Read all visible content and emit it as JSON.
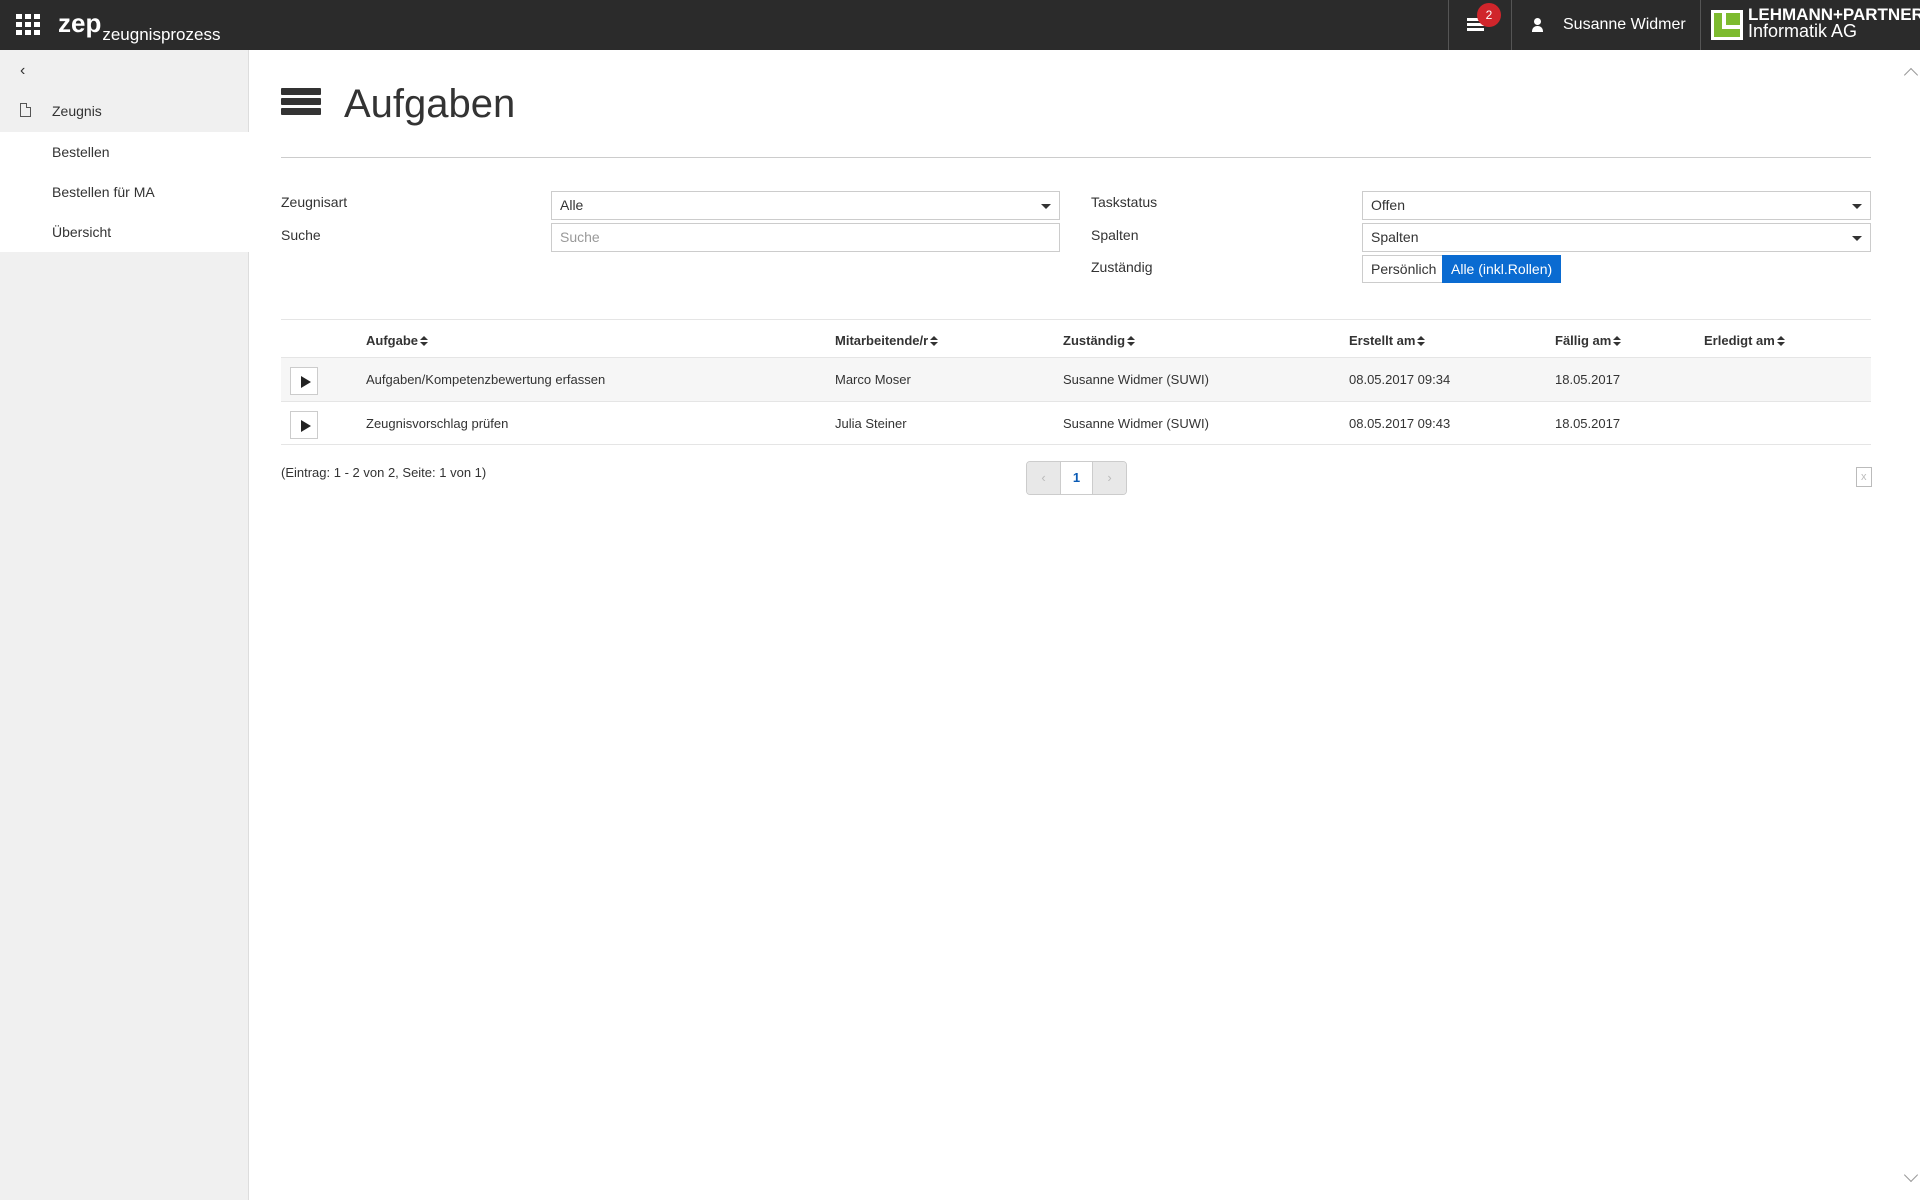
{
  "header": {
    "brand_main": "zep",
    "brand_sub": "zeugnisprozess",
    "notification_count": "2",
    "user_name": "Susanne Widmer",
    "company_line1": "LEHMANN+PARTNER",
    "company_line2": "Informatik AG"
  },
  "sidebar": {
    "section_label": "Zeugnis",
    "items": [
      {
        "label": "Bestellen"
      },
      {
        "label": "Bestellen für MA"
      },
      {
        "label": "Übersicht"
      }
    ]
  },
  "page": {
    "title": "Aufgaben"
  },
  "filters": {
    "zeugnisart_label": "Zeugnisart",
    "zeugnisart_value": "Alle",
    "suche_label": "Suche",
    "suche_placeholder": "Suche",
    "taskstatus_label": "Taskstatus",
    "taskstatus_value": "Offen",
    "spalten_label": "Spalten",
    "spalten_value": "Spalten",
    "zustaendig_label": "Zuständig",
    "zustaendig_options": [
      "Persönlich",
      "Alle (inkl.Rollen)"
    ],
    "zustaendig_selected": "Alle (inkl.Rollen)"
  },
  "table": {
    "columns": [
      "Aufgabe",
      "Mitarbeitende/r",
      "Zuständig",
      "Erstellt am",
      "Fällig am",
      "Erledigt am"
    ],
    "rows": [
      {
        "aufgabe": "Aufgaben/Kompetenzbewertung erfassen",
        "mitarbeitende": "Marco Moser",
        "zustaendig": "Susanne Widmer (SUWI)",
        "erstellt": "08.05.2017 09:34",
        "faellig": "18.05.2017",
        "erledigt": ""
      },
      {
        "aufgabe": "Zeugnisvorschlag prüfen",
        "mitarbeitende": "Julia Steiner",
        "zustaendig": "Susanne Widmer (SUWI)",
        "erstellt": "08.05.2017 09:43",
        "faellig": "18.05.2017",
        "erledigt": ""
      }
    ]
  },
  "pagination": {
    "info": "(Eintrag: 1 - 2 von 2, Seite: 1 von 1)",
    "prev": "‹",
    "current": "1",
    "next": "›"
  },
  "colors": {
    "topbar": "#2b2b2b",
    "accent": "#0a6bd1",
    "badge": "#d0252b",
    "logo_green": "#7dbb2f"
  }
}
